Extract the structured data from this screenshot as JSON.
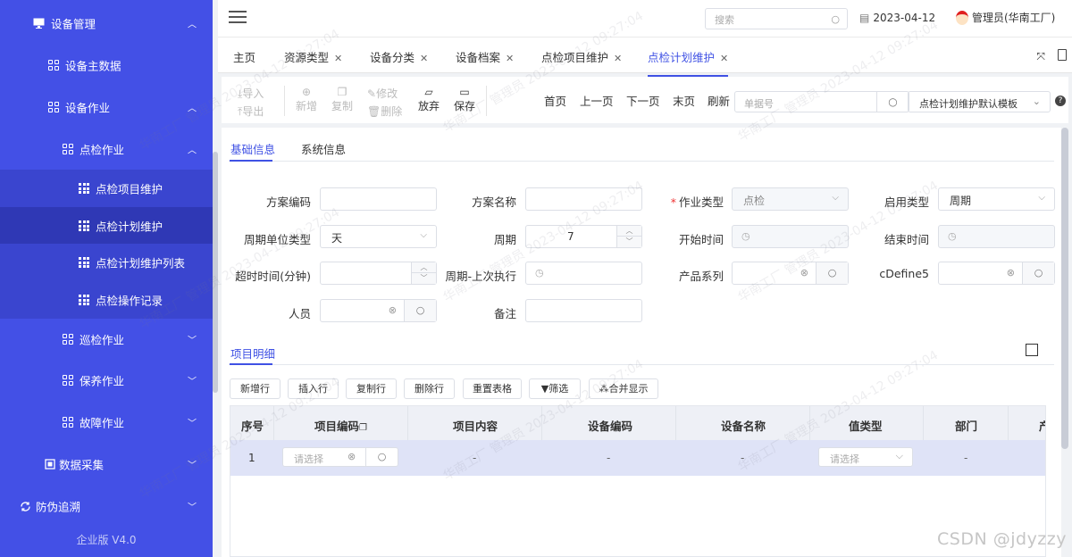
{
  "sidebar": {
    "items": [
      {
        "label": "设备管理",
        "icon": "monitor-icon",
        "chevron": "up"
      },
      {
        "label": "设备主数据",
        "icon": "grid-icon"
      },
      {
        "label": "设备作业",
        "icon": "grid-icon",
        "chevron": "up"
      },
      {
        "label": "点检作业",
        "icon": "grid-icon",
        "chevron": "up"
      },
      {
        "label": "点检项目维护",
        "icon": "table-icon"
      },
      {
        "label": "点检计划维护",
        "icon": "table-icon",
        "active": true
      },
      {
        "label": "点检计划维护列表",
        "icon": "table-icon"
      },
      {
        "label": "点检操作记录",
        "icon": "table-icon"
      },
      {
        "label": "巡检作业",
        "icon": "grid-icon",
        "chevron": "down"
      },
      {
        "label": "保养作业",
        "icon": "grid-icon",
        "chevron": "down"
      },
      {
        "label": "故障作业",
        "icon": "grid-icon",
        "chevron": "down"
      },
      {
        "label": "数据采集",
        "icon": "data-icon",
        "chevron": "down"
      },
      {
        "label": "防伪追溯",
        "icon": "trace-icon",
        "chevron": "down"
      }
    ],
    "version": "企业版 V4.0"
  },
  "header": {
    "search_placeholder": "搜索",
    "date": "2023-04-12",
    "user": "管理员(华南工厂)"
  },
  "tabs": [
    {
      "label": "主页",
      "closable": false
    },
    {
      "label": "资源类型",
      "closable": true
    },
    {
      "label": "设备分类",
      "closable": true
    },
    {
      "label": "设备档案",
      "closable": true
    },
    {
      "label": "点检项目维护",
      "closable": true
    },
    {
      "label": "点检计划维护",
      "closable": true,
      "active": true
    }
  ],
  "toolbar": {
    "import": "导入",
    "export": "导出",
    "add": "新增",
    "copy": "复制",
    "edit": "修改",
    "delete": "删除",
    "discard": "放弃",
    "save": "保存",
    "first": "首页",
    "prev": "上一页",
    "next": "下一页",
    "last": "末页",
    "refresh": "刷新",
    "bill_placeholder": "单据号",
    "template": "点检计划维护默认模板"
  },
  "subtabs": [
    "基础信息",
    "系统信息"
  ],
  "form": {
    "plan_code": {
      "label": "方案编码",
      "value": ""
    },
    "plan_name": {
      "label": "方案名称",
      "value": ""
    },
    "work_type": {
      "label": "作业类型",
      "value": "点检",
      "required": true
    },
    "enable_type": {
      "label": "启用类型",
      "value": "周期"
    },
    "cycle_unit": {
      "label": "周期单位类型",
      "value": "天"
    },
    "cycle": {
      "label": "周期",
      "value": "7"
    },
    "start_time": {
      "label": "开始时间",
      "value": ""
    },
    "end_time": {
      "label": "结束时间",
      "value": ""
    },
    "timeout": {
      "label": "超时时间(分钟)",
      "value": ""
    },
    "last_exec": {
      "label": "周期-上次执行",
      "value": ""
    },
    "product_series": {
      "label": "产品系列",
      "value": ""
    },
    "cdefine5": {
      "label": "cDefine5",
      "value": ""
    },
    "person": {
      "label": "人员",
      "value": ""
    },
    "remark": {
      "label": "备注",
      "value": ""
    }
  },
  "detail": {
    "title": "项目明细",
    "buttons": [
      "新增行",
      "插入行",
      "复制行",
      "删除行",
      "重置表格",
      "筛选",
      "合并显示"
    ],
    "columns": [
      "序号",
      "项目编码",
      "项目内容",
      "设备编码",
      "设备名称",
      "值类型",
      "部门",
      "产"
    ],
    "rows": [
      {
        "index": "1",
        "item_code_placeholder": "请选择",
        "content": "-",
        "device_code": "-",
        "device_name": "-",
        "value_type_placeholder": "请选择",
        "dept": "-"
      }
    ]
  },
  "watermark": "华南工厂 管理员 2023-04-12 09:27:04",
  "corner_credit": "CSDN @jdyzzy"
}
